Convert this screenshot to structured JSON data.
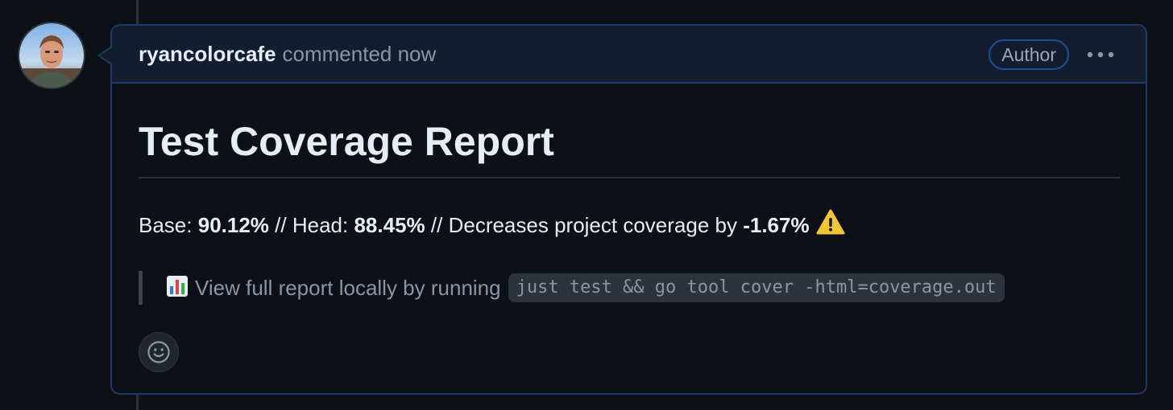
{
  "comment": {
    "author": "ryancolorcafe",
    "meta": "commented now",
    "badge": "Author",
    "avatar_icon": "user-avatar"
  },
  "report": {
    "title": "Test Coverage Report",
    "base_label": "Base:",
    "base_value": "90.12%",
    "sep1": "//",
    "head_label": "Head:",
    "head_value": "88.45%",
    "sep2": "//",
    "change_label": "Decreases project coverage by",
    "change_value": "-1.67%",
    "warning_icon": "warning-icon",
    "note_icon": "bar-chart-icon",
    "note_text": "View full report locally by running",
    "note_code": "just test && go tool cover -html=coverage.out"
  },
  "actions": {
    "more_icon": "kebab-horizontal-icon",
    "reaction_icon": "smiley-icon"
  },
  "colors": {
    "background": "#0d1117",
    "header_bg": "#121d2f",
    "border_accent": "#1f3a66",
    "text_primary": "#e6edf3",
    "text_muted": "#8d96a0",
    "warning": "#f2c537"
  }
}
